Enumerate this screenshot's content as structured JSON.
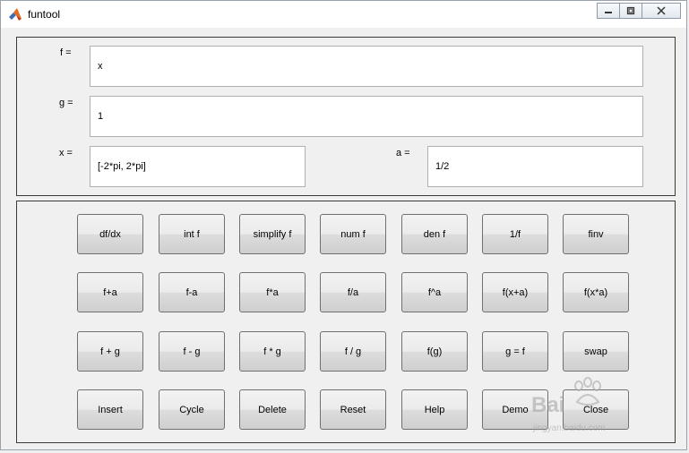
{
  "window": {
    "title": "funtool"
  },
  "fields": {
    "f_label": "f =",
    "f_value": "x",
    "g_label": "g =",
    "g_value": "1",
    "x_label": "x =",
    "x_value": "[-2*pi, 2*pi]",
    "a_label": "a =",
    "a_value": "1/2"
  },
  "buttons": {
    "row1": [
      "df/dx",
      "int f",
      "simplify f",
      "num f",
      "den f",
      "1/f",
      "finv"
    ],
    "row2": [
      "f+a",
      "f-a",
      "f*a",
      "f/a",
      "f^a",
      "f(x+a)",
      "f(x*a)"
    ],
    "row3": [
      "f + g",
      "f - g",
      "f * g",
      "f / g",
      "f(g)",
      "g = f",
      "swap"
    ],
    "row4": [
      "Insert",
      "Cycle",
      "Delete",
      "Reset",
      "Help",
      "Demo",
      "Close"
    ]
  },
  "watermark": {
    "brand": "Bai",
    "url": "jingyan.baidu.com"
  },
  "colors": {
    "panel_bg": "#f0f0f0",
    "field_bg": "#ffffff",
    "border": "#3a3a3a"
  }
}
